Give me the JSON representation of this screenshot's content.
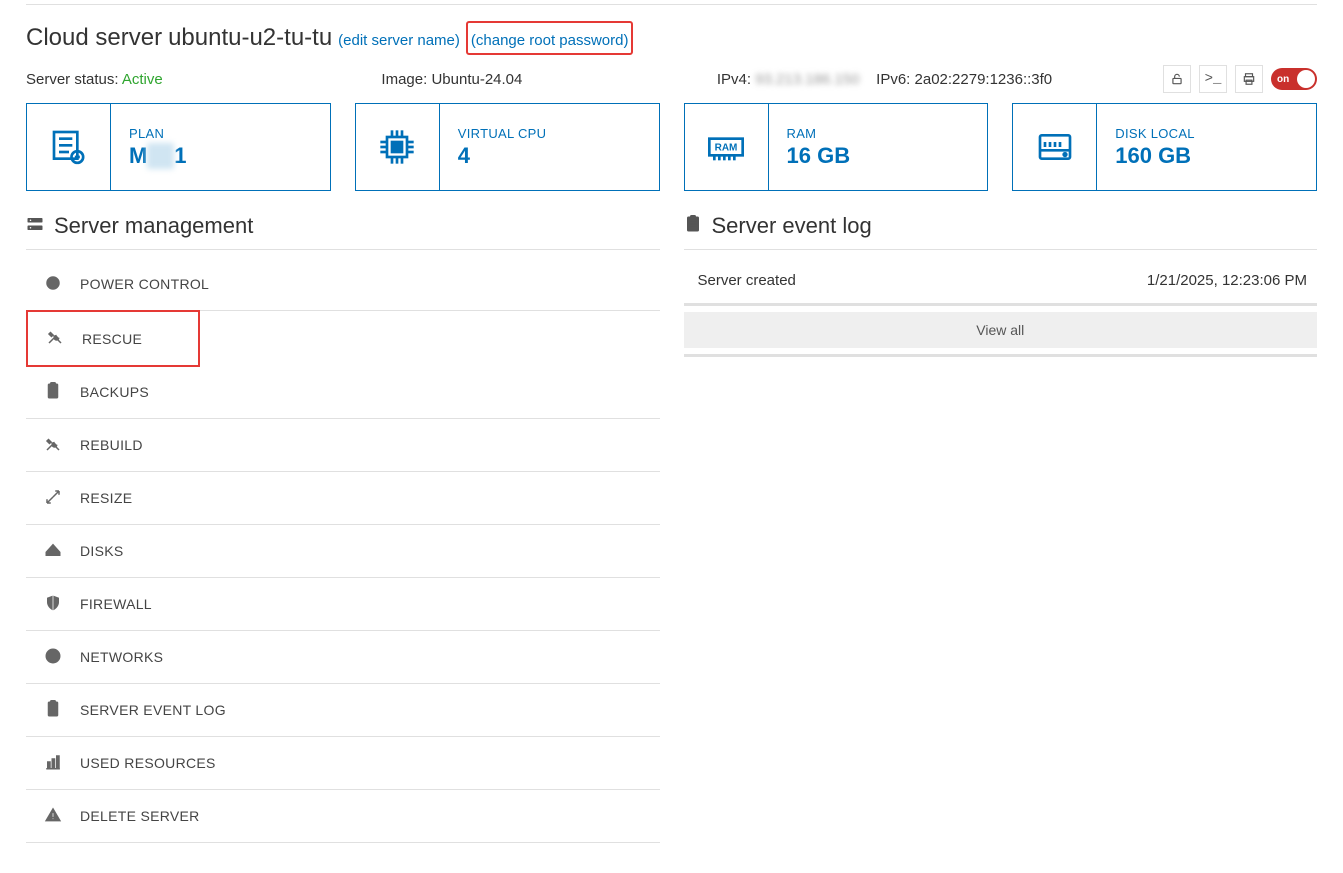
{
  "header": {
    "title_prefix": "Cloud server ",
    "server_name": "ubuntu-u2-tu-tu",
    "edit_link": "(edit server name)",
    "change_pw_link": "(change root password)",
    "status_label": "Server status: ",
    "status_value": "Active",
    "image_label": "Image: ",
    "image_value": "Ubuntu-24.04",
    "ipv4_label": "IPv4: ",
    "ipv4_value": "93.213.186.150",
    "ipv6_label": "IPv6: ",
    "ipv6_value": "2a02:2279:1236::3f0",
    "toggle_label": "on"
  },
  "cards": [
    {
      "key": "PLAN",
      "value_pre": "M",
      "value_blur": "id-",
      "value_post": "1",
      "icon": "plan"
    },
    {
      "key": "VIRTUAL CPU",
      "value": "4",
      "icon": "cpu"
    },
    {
      "key": "RAM",
      "value": "16 GB",
      "icon": "ram"
    },
    {
      "key": "DISK LOCAL",
      "value": "160 GB",
      "icon": "disk"
    }
  ],
  "sections": {
    "management_title": "Server management",
    "eventlog_title": "Server event log"
  },
  "management_items": [
    {
      "label": "POWER CONTROL",
      "icon": "power",
      "highlight": false
    },
    {
      "label": "RESCUE",
      "icon": "tools",
      "highlight": true
    },
    {
      "label": "BACKUPS",
      "icon": "clip",
      "highlight": false
    },
    {
      "label": "REBUILD",
      "icon": "tools",
      "highlight": false
    },
    {
      "label": "RESIZE",
      "icon": "resize",
      "highlight": false
    },
    {
      "label": "DISKS",
      "icon": "disk2",
      "highlight": false
    },
    {
      "label": "FIREWALL",
      "icon": "shield",
      "highlight": false
    },
    {
      "label": "NETWORKS",
      "icon": "net",
      "highlight": false
    },
    {
      "label": "SERVER EVENT LOG",
      "icon": "clip",
      "highlight": false
    },
    {
      "label": "USED RESOURCES",
      "icon": "chart",
      "highlight": false
    },
    {
      "label": "DELETE SERVER",
      "icon": "warn",
      "highlight": false
    }
  ],
  "events": [
    {
      "text": "Server created",
      "time": "1/21/2025, 12:23:06 PM"
    }
  ],
  "view_all": "View all"
}
